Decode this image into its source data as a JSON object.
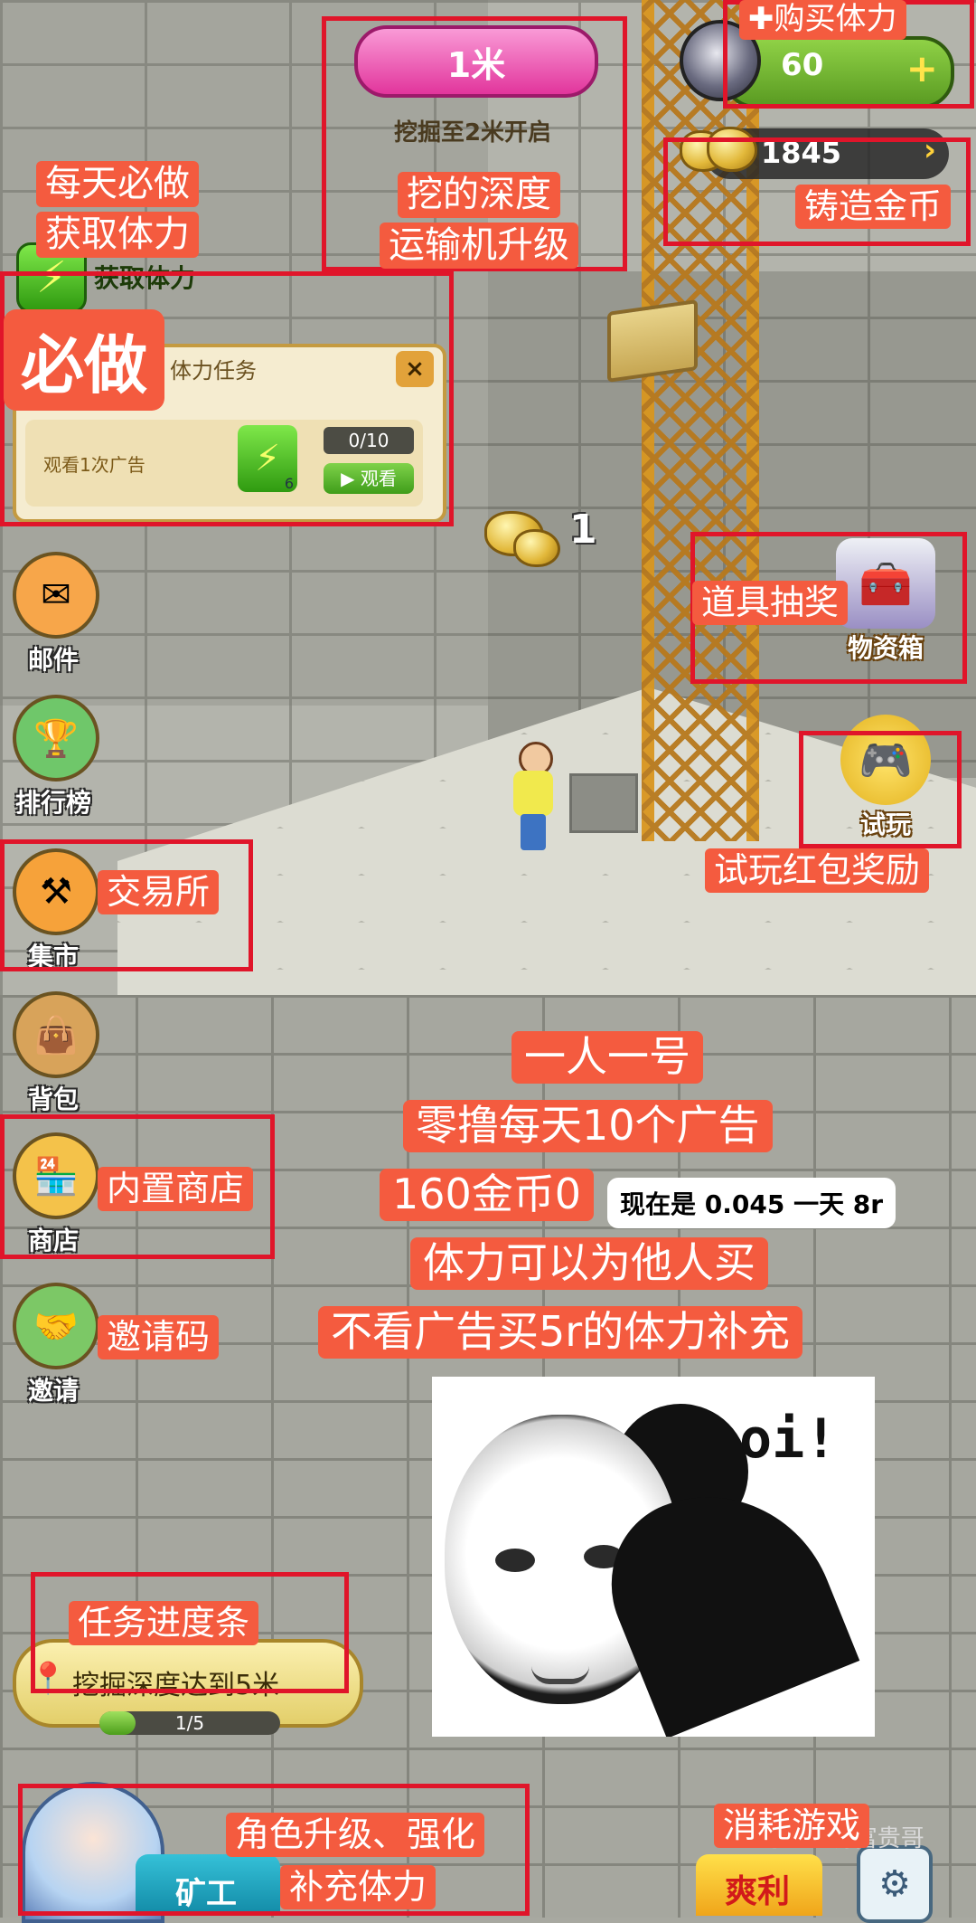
{
  "hud": {
    "depth_value": "1米",
    "depth_unlock": "挖掘至2米开启",
    "energy_value": "60",
    "energy_plus": "+",
    "coins_value": "1845",
    "coins_arrow": "›",
    "floating_digit": "1"
  },
  "task_panel": {
    "get_energy_label": "获取体力",
    "title": "体力任务",
    "close": "×",
    "task_text": "观看1次广告",
    "reward_icon": "lightning-icon",
    "reward_count": "6",
    "progress": "0/10",
    "watch_label": "▶ 观看"
  },
  "side_menu": [
    {
      "label": "邮件",
      "icon": "mail-icon",
      "glyph": "✉",
      "color": "#f7a64a"
    },
    {
      "label": "排行榜",
      "icon": "trophy-icon",
      "glyph": "🏆",
      "color": "#6fc76a"
    },
    {
      "label": "集市",
      "icon": "hammer-icon",
      "glyph": "⚒",
      "color": "#f6a23a"
    },
    {
      "label": "背包",
      "icon": "backpack-icon",
      "glyph": "👜",
      "color": "#d8a35a"
    },
    {
      "label": "商店",
      "icon": "shop-icon",
      "glyph": "🏪",
      "color": "#f4c24a"
    },
    {
      "label": "邀请",
      "icon": "handshake-icon",
      "glyph": "🤝",
      "color": "#7cc866"
    }
  ],
  "right_menu": {
    "supply_box_label": "物资箱",
    "trial_label": "试玩"
  },
  "bottom": {
    "mission_text": "挖掘深度达到5米",
    "mission_progress_text": "1/5",
    "mission_progress_fraction": 0.2,
    "miner_button": "矿工",
    "bonus_button": "爽利",
    "watermark": "公众号 · 链游富贵哥"
  },
  "annotations": {
    "buy_energy": "✚购买体力",
    "daily_line1": "每天必做",
    "daily_line2": "获取体力",
    "must_do": "必做",
    "depth_line1": "挖的深度",
    "depth_line2": "运输机升级",
    "mint_coins": "铸造金币",
    "item_lottery": "道具抽奖",
    "trial_reward": "试玩红包奖励",
    "exchange": "交易所",
    "builtin_shop": "内置商店",
    "invite_code": "邀请码",
    "mission_bar": "任务进度条",
    "role_line1": "角色升级、强化",
    "role_line2": "补充体力",
    "consume_game": "消耗游戏"
  },
  "promo": {
    "line1": "一人一号",
    "line2": "零撸每天10个广告",
    "line3": "160金币0",
    "line3_overlay": "现在是 0.045 一天 8r",
    "line4": "体力可以为他人买",
    "line5": "不看广告买5r的体力补充"
  },
  "meme": {
    "text": "oi!"
  },
  "colors": {
    "annotation_red": "#e0152a",
    "tag_orange": "#f45b3f",
    "energy_green": "#5a9b22",
    "depth_pink": "#e2359c"
  }
}
